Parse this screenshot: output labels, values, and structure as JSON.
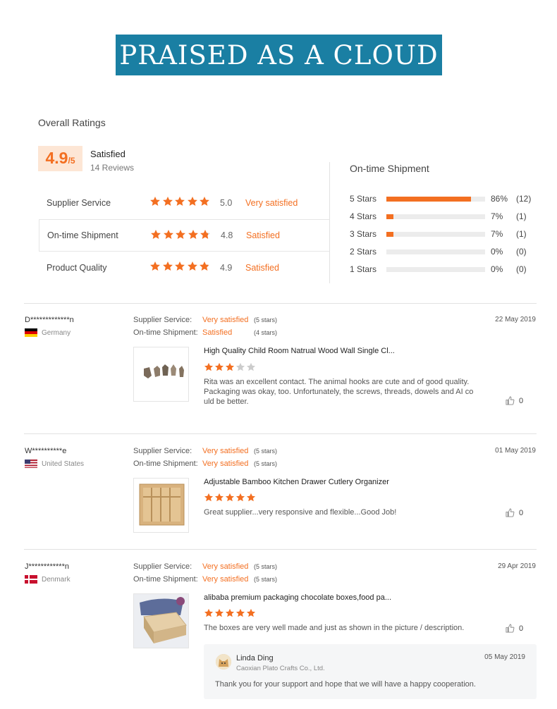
{
  "banner": {
    "title": "PRAISED AS A CLOUD"
  },
  "overall": {
    "title": "Overall Ratings",
    "score": "4.9",
    "score_max": "/5",
    "status": "Satisfied",
    "reviews": "14 Reviews",
    "metrics": [
      {
        "name": "Supplier Service",
        "rating": 5.0,
        "value": "5.0",
        "desc": "Very satisfied"
      },
      {
        "name": "On-time Shipment",
        "rating": 4.8,
        "value": "4.8",
        "desc": "Satisfied"
      },
      {
        "name": "Product Quality",
        "rating": 4.9,
        "value": "4.9",
        "desc": "Satisfied"
      }
    ]
  },
  "shipment": {
    "title": "On-time Shipment",
    "rows": [
      {
        "label": "5  Stars",
        "pct": 86,
        "pct_text": "86%",
        "count": "(12)"
      },
      {
        "label": "4  Stars",
        "pct": 7,
        "pct_text": "7%",
        "count": "(1)"
      },
      {
        "label": "3  Stars",
        "pct": 7,
        "pct_text": "7%",
        "count": "(1)"
      },
      {
        "label": "2  Stars",
        "pct": 0,
        "pct_text": "0%",
        "count": "(0)"
      },
      {
        "label": "1  Stars",
        "pct": 0,
        "pct_text": "0%",
        "count": "(0)"
      }
    ]
  },
  "reviews": [
    {
      "reviewer": "D*************n",
      "country": "Germany",
      "service_label": "Supplier Service:",
      "service_value": "Very satisfied",
      "service_stars": "(5 stars)",
      "shipment_label": "On-time Shipment:",
      "shipment_value": "Satisfied",
      "shipment_stars": "(4 stars)",
      "date": "22 May 2019",
      "product": "High Quality Child Room Natrual Wood Wall Single Cl...",
      "rating": 3,
      "comment": "Rita was an excellent contact. The animal hooks are cute and of good quality. Packaging was okay, too. Unfortunately, the screws, threads, dowels and AI co uld be better.",
      "likes": "0"
    },
    {
      "reviewer": "W**********e",
      "country": "United States",
      "service_label": "Supplier Service:",
      "service_value": "Very satisfied",
      "service_stars": "(5 stars)",
      "shipment_label": "On-time Shipment:",
      "shipment_value": "Very satisfied",
      "shipment_stars": "(5 stars)",
      "date": "01 May 2019",
      "product": "Adjustable Bamboo Kitchen Drawer Cutlery Organizer",
      "rating": 5,
      "comment": "Great supplier...very responsive and flexible...Good Job!",
      "likes": "0"
    },
    {
      "reviewer": "J************n",
      "country": "Denmark",
      "service_label": "Supplier Service:",
      "service_value": "Very satisfied",
      "service_stars": "(5 stars)",
      "shipment_label": "On-time Shipment:",
      "shipment_value": "Very satisfied",
      "shipment_stars": "(5 stars)",
      "date": "29 Apr 2019",
      "product": "alibaba premium packaging chocolate boxes,food pa...",
      "rating": 5,
      "comment": "The boxes are very well made and just as shown in the picture / description.",
      "likes": "0"
    }
  ],
  "reply": {
    "name": "Linda Ding",
    "company": "Caoxian Plato Crafts Co., Ltd.",
    "date": "05 May 2019",
    "text": "Thank you for your support and hope that we will have a happy cooperation."
  },
  "colors": {
    "accent": "#f36f21",
    "banner": "#1a7fa3",
    "empty_star": "#cccccc"
  },
  "icons": {
    "star": "star-icon",
    "like": "thumbs-up-icon"
  }
}
